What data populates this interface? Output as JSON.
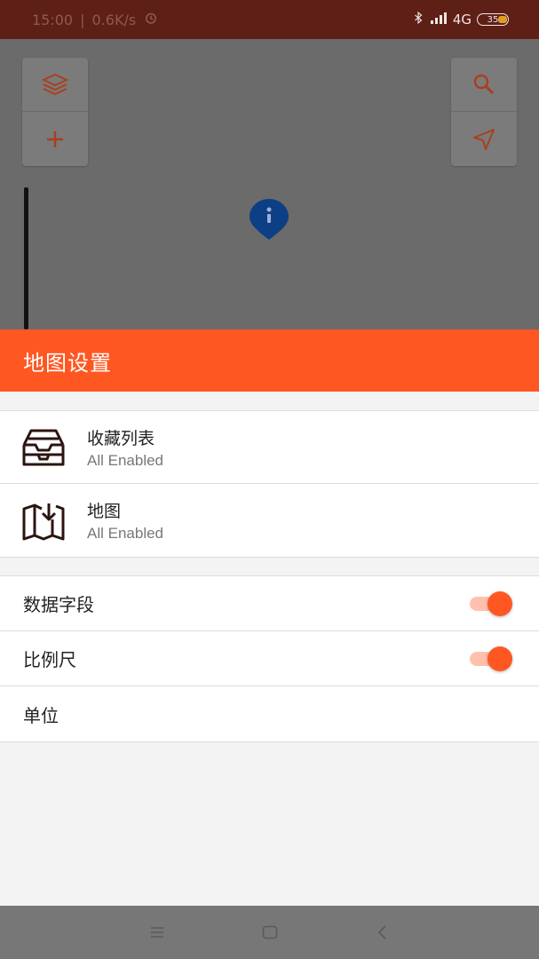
{
  "status_bar": {
    "time": "15:00",
    "separator": "|",
    "speed": "0.6K/s",
    "network": "4G",
    "battery": "35"
  },
  "map": {
    "left_buttons": [
      "layers-icon",
      "zoom-in-icon"
    ],
    "right_buttons": [
      "search-icon",
      "navigate-icon"
    ],
    "marker": "info-pin-icon"
  },
  "sheet": {
    "title": "地图设置",
    "list_items": [
      {
        "icon": "inbox-tray-icon",
        "title": "收藏列表",
        "subtitle": "All Enabled"
      },
      {
        "icon": "map-download-icon",
        "title": "地图",
        "subtitle": "All Enabled"
      }
    ],
    "settings": [
      {
        "label": "数据字段",
        "toggle": true
      },
      {
        "label": "比例尺",
        "toggle": true
      },
      {
        "label": "单位"
      }
    ]
  },
  "navbar": [
    "menu-icon",
    "home-icon",
    "back-icon"
  ],
  "colors": {
    "accent": "#ff5722",
    "status_bar": "#5e1f17",
    "map_dim": "#6b6b6b"
  }
}
